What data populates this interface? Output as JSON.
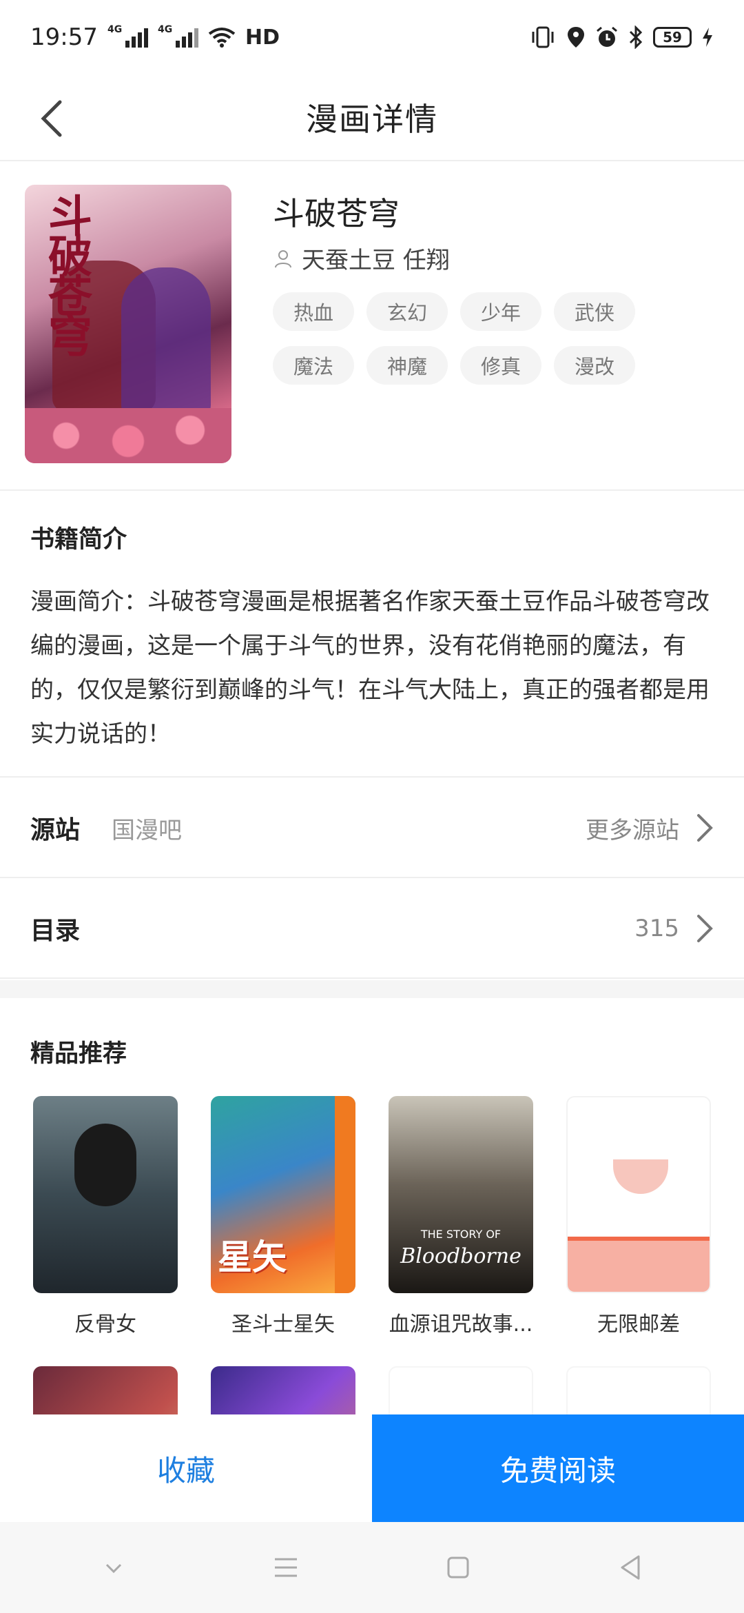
{
  "status_bar": {
    "time": "19:57",
    "net_type": "4G",
    "hd": "HD",
    "battery": "59",
    "icons": [
      "signal-icon",
      "wifi-icon",
      "vibrate-icon",
      "location-icon",
      "alarm-icon",
      "bluetooth-icon",
      "battery-icon",
      "charging-icon"
    ]
  },
  "header": {
    "title": "漫画详情",
    "back_icon": "back-icon"
  },
  "book": {
    "title": "斗破苍穹",
    "authors": "天蚕土豆 任翔",
    "cover_title_art": "斗破苍穹",
    "tags": [
      "热血",
      "玄幻",
      "少年",
      "武侠",
      "魔法",
      "神魔",
      "修真",
      "漫改"
    ]
  },
  "intro": {
    "section_title": "书籍简介",
    "text": "漫画简介：斗破苍穹漫画是根据著名作家天蚕土豆作品斗破苍穹改编的漫画，这是一个属于斗气的世界，没有花俏艳丽的魔法，有的，仅仅是繁衍到巅峰的斗气！在斗气大陆上，真正的强者都是用实力说话的！"
  },
  "source_row": {
    "label": "源站",
    "value": "国漫吧",
    "more": "更多源站"
  },
  "catalog_row": {
    "label": "目录",
    "count": "315"
  },
  "recommend": {
    "section_title": "精品推荐",
    "items": [
      {
        "name": "反骨女"
      },
      {
        "name": "圣斗士星矢",
        "cover_art": "星矢"
      },
      {
        "name": "血源诅咒故事...",
        "cover_art": "Bloodborne",
        "cover_art_sub": "THE STORY OF"
      },
      {
        "name": "无限邮差"
      },
      {
        "name": ""
      },
      {
        "name": ""
      },
      {
        "name": ""
      },
      {
        "name": ""
      }
    ]
  },
  "actions": {
    "favorite": "收藏",
    "read_free": "免费阅读"
  },
  "colors": {
    "accent": "#0d84ff",
    "favorite_text": "#1e7fe0",
    "divider": "#eeeeee"
  }
}
